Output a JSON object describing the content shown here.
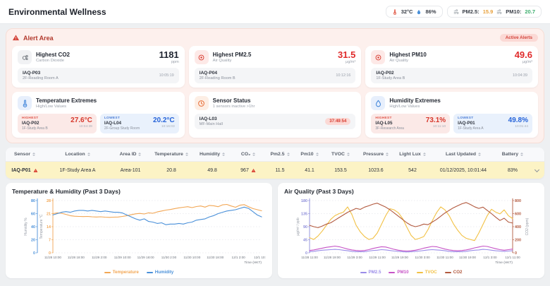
{
  "header": {
    "title": "Environmental Wellness",
    "env_pill": {
      "temperature": "32°C",
      "humidity": "86%"
    },
    "pm_pill": {
      "pm25_label": "PM2.5:",
      "pm25_value": "15.9",
      "pm10_label": "PM10:",
      "pm10_value": "20.7"
    }
  },
  "alert": {
    "title": "Alert Area",
    "badge": "Active Alerts",
    "top_cards": [
      {
        "title": "Highest CO2",
        "subtitle": "Carbon Dioxide",
        "value": "1181",
        "unit": "ppm",
        "sensor": "IAQ-P03",
        "location": "2F-Reading Room A",
        "time": "10:05:19"
      },
      {
        "title": "Highest PM2.5",
        "subtitle": "Air Quality",
        "value": "31.5",
        "unit": "μg/m³",
        "sensor": "IAQ-P04",
        "location": "2F-Reading Room B",
        "time": "10:12:16"
      },
      {
        "title": "Highest PM10",
        "subtitle": "Air Quality",
        "value": "49.6",
        "unit": "μg/m³",
        "sensor": "IAQ-P02",
        "location": "1F-Study Area B",
        "time": "10:04:39"
      }
    ],
    "temperature_extremes": {
      "title": "Temperature Extremes",
      "subtitle": "High/Low Values",
      "highest": {
        "label": "HIGHEST",
        "sensor": "IAQ-P02",
        "location": "1F-Study Area B",
        "value": "27.6°C",
        "time": "10:04:39"
      },
      "lowest": {
        "label": "LOWEST",
        "sensor": "IAQ-L04",
        "location": "2F-Group Study Room",
        "value": "20.2°C",
        "time": "10:16:03"
      }
    },
    "sensor_status": {
      "title": "Sensor Status",
      "subtitle": "1 sensors inactive >1hr",
      "sensor": "IAQ-L03",
      "location": "MF-Main Hall",
      "duration": "37:49:54"
    },
    "humidity_extremes": {
      "title": "Humidity Extremes",
      "subtitle": "High/Low Values",
      "highest": {
        "label": "HIGHEST",
        "sensor": "IAQ-L05",
        "location": "3F-Research Area",
        "value": "73.1%",
        "time": "10:11:10"
      },
      "lowest": {
        "label": "LOWEST",
        "sensor": "IAQ-P01",
        "location": "1F-Study Area A",
        "value": "49.8%",
        "time": "10:01:44"
      }
    }
  },
  "table": {
    "columns": [
      "Sensor",
      "Location",
      "Area ID",
      "Temperature",
      "Humidity",
      "CO₂",
      "Pm2.5",
      "Pm10",
      "TVOC",
      "Pressure",
      "Light Lux",
      "Last Updated",
      "Battery"
    ],
    "rows": [
      {
        "sensor": "IAQ-P01",
        "location": "1F-Study Area A",
        "area_id": "Area-101",
        "temperature": "20.8",
        "humidity": "49.8",
        "co2": "967",
        "pm25": "11.5",
        "pm10": "41.1",
        "tvoc": "153.5",
        "pressure": "1023.6",
        "light_lux": "542",
        "last_updated": "01/12/2025, 10:01:44",
        "battery": "83%"
      }
    ]
  },
  "chart_data": [
    {
      "type": "line",
      "title": "Temperature & Humidity (Past 3 Days)",
      "xlabel": "Time (HKT)",
      "x_ticks": [
        "11/28 10:00",
        "11/28 18:00",
        "11/29 2:00",
        "11/29 10:00",
        "11/29 18:00",
        "11/30 2:00",
        "11/30 10:00",
        "11/30 18:00",
        "12/1 2:00",
        "12/1 10:00"
      ],
      "grid": true,
      "legend_position": "bottom",
      "left_axes": [
        {
          "name": "humidity",
          "label": "Humidity %",
          "ticks": [
            0,
            20,
            40,
            60,
            80
          ],
          "color": "#4a90d9"
        },
        {
          "name": "temperature",
          "label": "Temperature °C",
          "ticks": [
            0,
            7,
            14,
            21,
            28
          ],
          "color": "#f2a654"
        }
      ],
      "right_axes": [],
      "series": [
        {
          "name": "Temperature",
          "axis": "temperature",
          "color": "#f2a654",
          "values": [
            21.0,
            21.4,
            21.2,
            20.6,
            19.9,
            19.6,
            19.5,
            19.4,
            19.5,
            19.3,
            19.2,
            19.3,
            19.1,
            19.0,
            19.1,
            19.2,
            19.5,
            19.9,
            20.4,
            20.9,
            21.1,
            20.8,
            21.4,
            21.2,
            21.9,
            22.4,
            22.9,
            23.2,
            23.7,
            24.1,
            24.4,
            24.7,
            24.2,
            24.8,
            25.1,
            24.5,
            25.4,
            25.2,
            24.7,
            25.7,
            25.9,
            25.1,
            24.4,
            25.5,
            25.8,
            24.7,
            23.7,
            23.1,
            22.5
          ]
        },
        {
          "name": "Humidity",
          "axis": "humidity",
          "color": "#4a90d9",
          "values": [
            58,
            60,
            62,
            63,
            62,
            64,
            65,
            65,
            64,
            65,
            64,
            63,
            64,
            63,
            62,
            62,
            61,
            58,
            55,
            52,
            50,
            52,
            48,
            47,
            45,
            46,
            43,
            44,
            44,
            45,
            44,
            46,
            47,
            50,
            51,
            52,
            55,
            57,
            60,
            62,
            64,
            65,
            66,
            68,
            70,
            68,
            63,
            58,
            55
          ]
        }
      ]
    },
    {
      "type": "line",
      "title": "Air Quality (Past 3 Days)",
      "xlabel": "Time (HKT)",
      "x_ticks": [
        "11/28 11:00",
        "11/28 19:00",
        "11/29 3:00",
        "11/29 11:00",
        "11/29 19:00",
        "11/30 3:00",
        "11/30 11:00",
        "11/30 19:00",
        "12/1 3:00",
        "12/1 11:00"
      ],
      "grid": true,
      "legend_position": "bottom",
      "left_axes": [
        {
          "name": "ugm3",
          "label": "μg/m³ / ppb",
          "ticks": [
            0,
            45,
            90,
            135,
            180
          ],
          "color": "#8c8cd9"
        }
      ],
      "right_axes": [
        {
          "name": "co2",
          "label": "CO2 (ppm)",
          "ticks": [
            0,
            200,
            400,
            600,
            800
          ],
          "color": "#b2593e"
        }
      ],
      "series": [
        {
          "name": "PM2.5",
          "axis": "ugm3",
          "color": "#9a8ce8",
          "values": [
            4,
            5,
            7,
            9,
            10,
            11,
            12,
            11,
            9,
            7,
            5,
            4,
            4,
            4,
            6,
            8,
            9,
            11,
            10,
            8,
            6,
            5,
            4,
            3,
            4,
            5,
            6,
            8,
            10,
            11,
            10,
            9,
            7,
            5,
            4,
            4,
            4,
            5,
            7,
            9,
            10,
            12,
            11,
            9,
            7,
            6,
            5,
            6,
            7
          ]
        },
        {
          "name": "PM10",
          "axis": "ugm3",
          "color": "#c653c6",
          "values": [
            8,
            10,
            13,
            16,
            19,
            21,
            23,
            21,
            17,
            13,
            10,
            8,
            7,
            8,
            11,
            15,
            18,
            21,
            20,
            16,
            12,
            9,
            7,
            6,
            7,
            9,
            12,
            16,
            19,
            22,
            21,
            17,
            13,
            10,
            8,
            7,
            8,
            10,
            13,
            17,
            20,
            23,
            22,
            18,
            14,
            11,
            9,
            11,
            13
          ]
        },
        {
          "name": "TVOC",
          "axis": "ugm3",
          "color": "#f2c144",
          "values": [
            52,
            46,
            58,
            75,
            95,
            115,
            128,
            135,
            140,
            158,
            132,
            95,
            72,
            56,
            46,
            50,
            68,
            98,
            128,
            152,
            148,
            138,
            118,
            88,
            60,
            46,
            50,
            56,
            80,
            110,
            138,
            158,
            148,
            128,
            100,
            78,
            60,
            50,
            46,
            42,
            68,
            98,
            128,
            150,
            140,
            134,
            148,
            128,
            118
          ]
        },
        {
          "name": "CO2",
          "axis": "co2",
          "color": "#b2593e",
          "values": [
            420,
            400,
            385,
            410,
            440,
            460,
            500,
            540,
            580,
            620,
            650,
            680,
            665,
            700,
            720,
            745,
            760,
            730,
            700,
            660,
            610,
            560,
            510,
            460,
            420,
            400,
            415,
            440,
            430,
            470,
            510,
            560,
            610,
            650,
            690,
            720,
            750,
            770,
            740,
            705,
            680,
            700,
            650,
            600,
            545,
            495,
            530,
            470,
            455
          ]
        }
      ]
    }
  ]
}
